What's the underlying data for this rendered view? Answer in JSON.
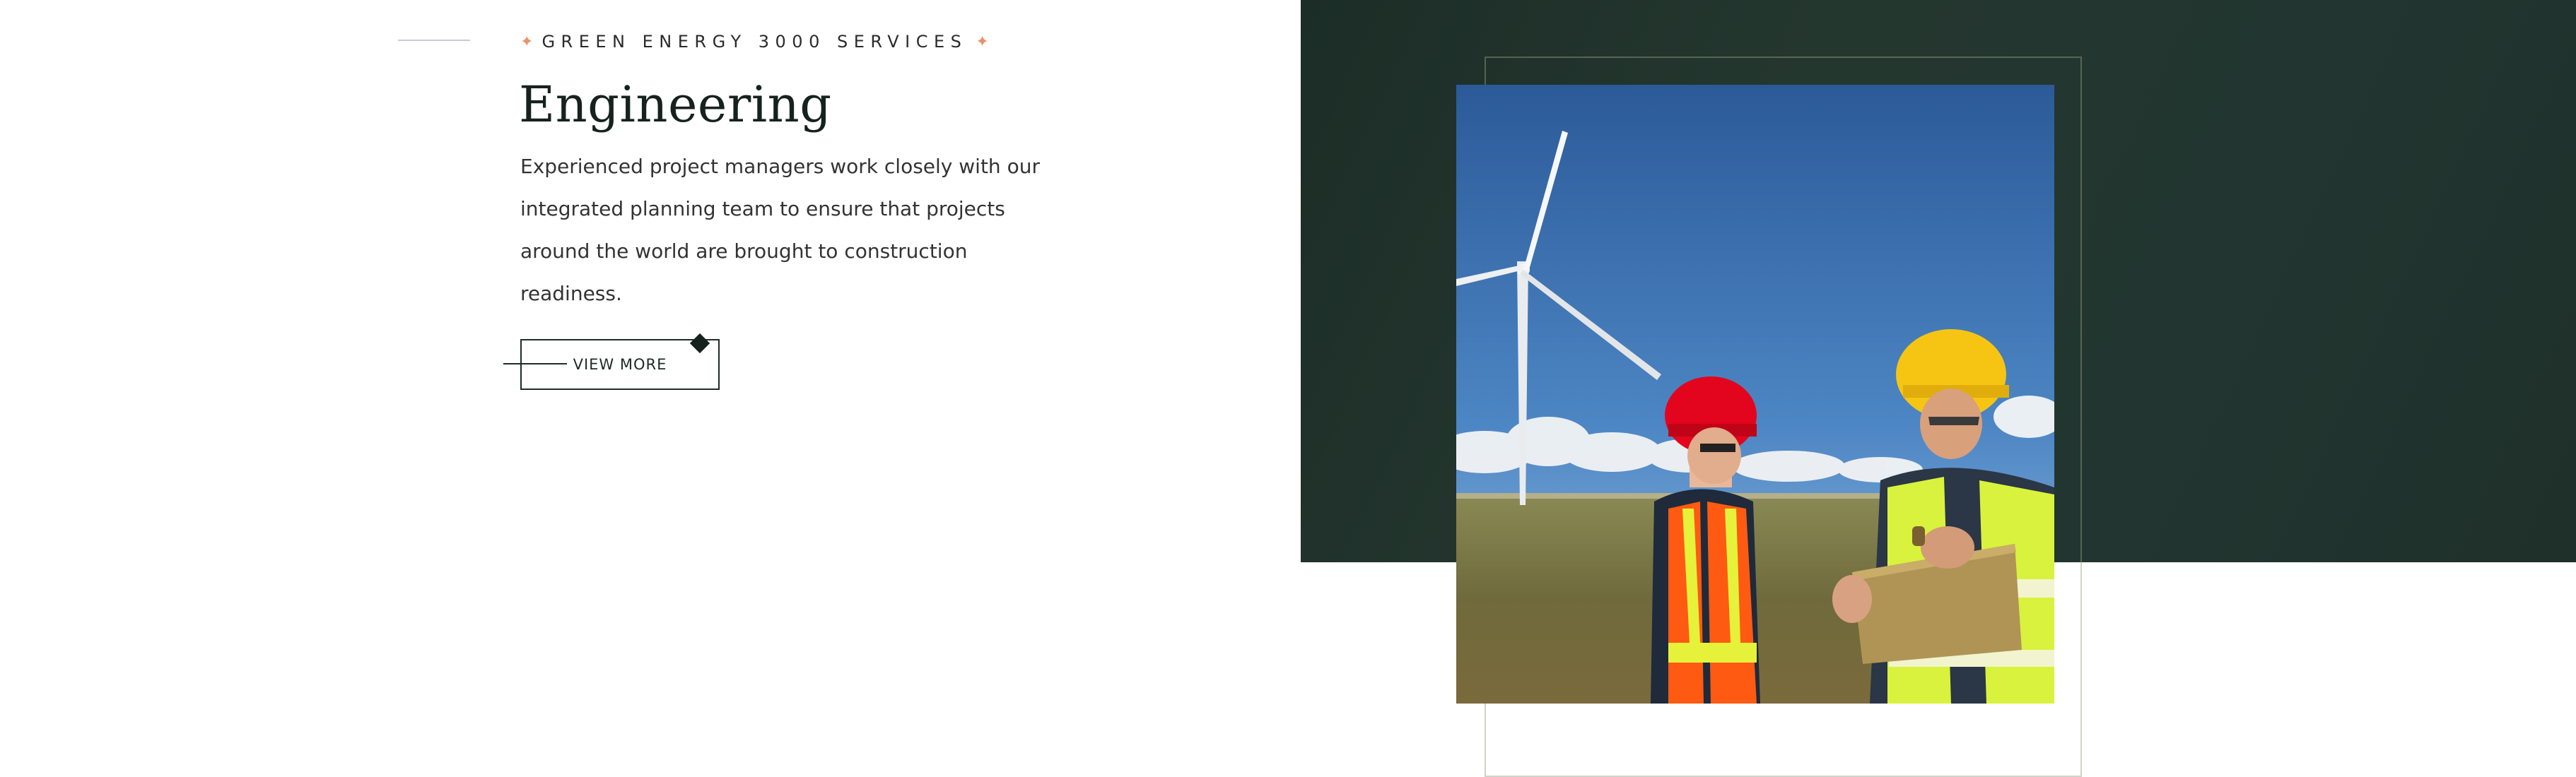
{
  "service": {
    "eyebrow_text": "GREEN ENERGY 3000 SERVICES",
    "title": "Engineering",
    "description": "Experienced project managers work closely with our integrated planning team to ensure that projects around the world are brought to construction readiness.",
    "button_label": "VIEW MORE"
  },
  "colors": {
    "accent_star": "#e7926a",
    "dark_panel": "#22352e",
    "text_dark": "#16221d"
  },
  "icons": {
    "eyebrow_star": "sparkle-icon",
    "button_ornament": "diamond-icon"
  }
}
